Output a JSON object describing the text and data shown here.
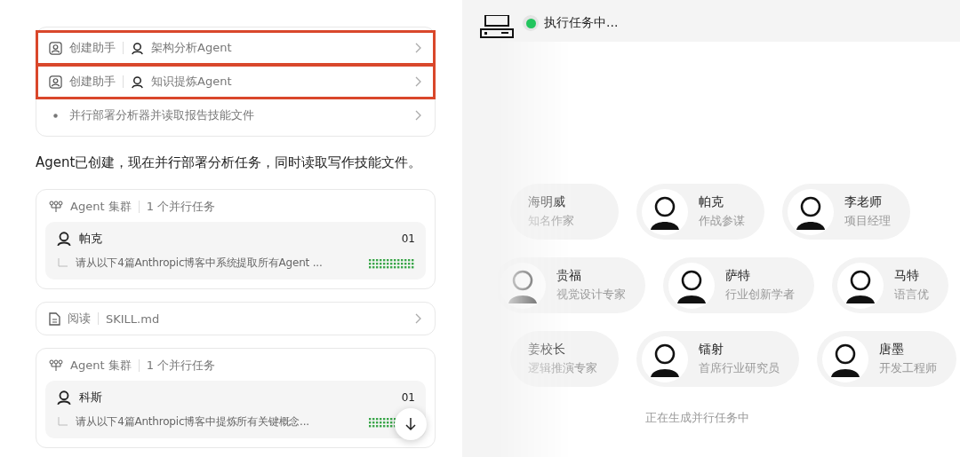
{
  "steps": [
    {
      "kind": "create",
      "action": "创建助手",
      "agent": "架构分析Agent",
      "highlighted": true
    },
    {
      "kind": "create",
      "action": "创建助手",
      "agent": "知识提炼Agent",
      "highlighted": true
    },
    {
      "kind": "note",
      "action": "并行部署分析器并读取报告技能文件",
      "highlighted": false
    }
  ],
  "message": "Agent已创建，现在并行部署分析任务，同时读取写作技能文件。",
  "blocks": [
    {
      "kind": "cluster",
      "title": "Agent 集群",
      "meta": "1 个并行任务",
      "agent": "帕克",
      "index": "01",
      "task": "请从以下4篇Anthropic博客中系统提取所有Agent ..."
    },
    {
      "kind": "read",
      "title": "阅读",
      "meta": "SKILL.md"
    },
    {
      "kind": "cluster",
      "title": "Agent 集群",
      "meta": "1 个并行任务",
      "agent": "科斯",
      "index": "01",
      "task": "请从以下4篇Anthropic博客中提炼所有关键概念..."
    }
  ],
  "status": {
    "text": "执行任务中...",
    "color": "#22c55e"
  },
  "team_rows": [
    [
      {
        "name": "海明威",
        "role": "知名作家",
        "kind": "plain"
      },
      {
        "name": "帕克",
        "role": "作战参谋",
        "kind": "avatar"
      },
      {
        "name": "李老师",
        "role": "项目经理",
        "kind": "avatar"
      }
    ],
    [
      {
        "name": "贵福",
        "role": "视觉设计专家",
        "kind": "avatar"
      },
      {
        "name": "萨特",
        "role": "行业创新学者",
        "kind": "avatar"
      },
      {
        "name": "马特",
        "role": "语言优",
        "kind": "avatar"
      }
    ],
    [
      {
        "name": "姜校长",
        "role": "逻辑推演专家",
        "kind": "plain"
      },
      {
        "name": "镭射",
        "role": "首席行业研究员",
        "kind": "avatar"
      },
      {
        "name": "唐墨",
        "role": "开发工程师",
        "kind": "avatar"
      }
    ]
  ],
  "footer": "正在生成并行任务中"
}
